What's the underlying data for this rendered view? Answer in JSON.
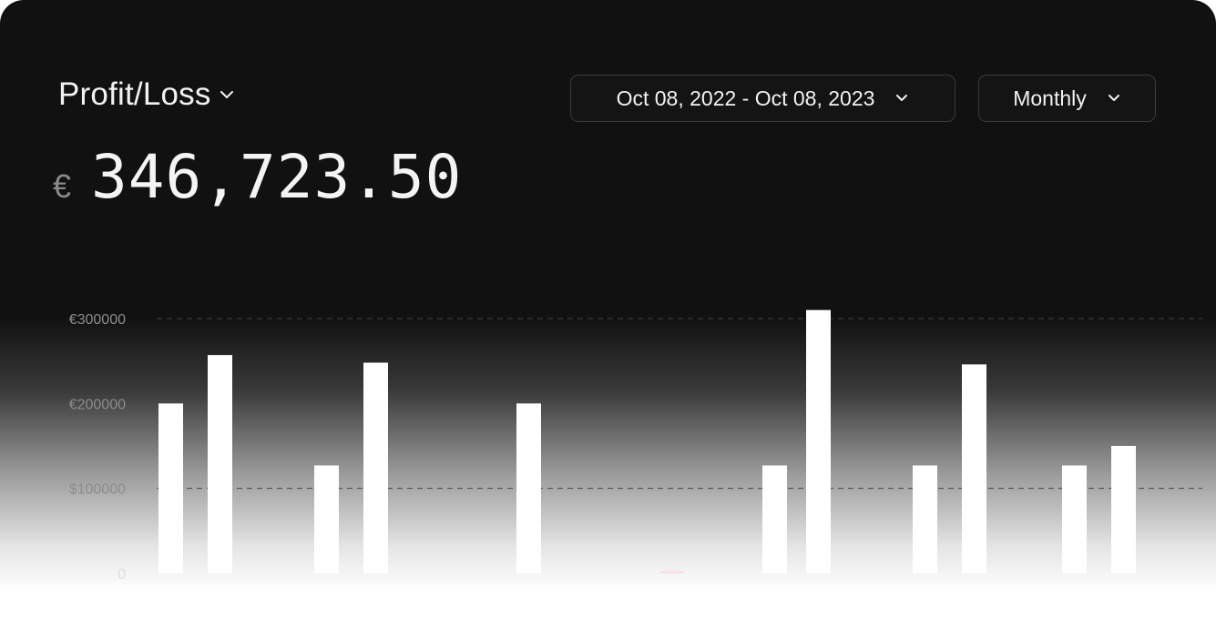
{
  "header": {
    "title": "Profit/Loss",
    "currency_symbol": "€",
    "amount": "346,723.50"
  },
  "controls": {
    "date_range": "Oct 08, 2022 - Oct 08, 2023",
    "period": "Monthly"
  },
  "colors": {
    "background_top": "#111111",
    "bar": "#ffffff",
    "highlight_bar": "#ffd6dc",
    "grid": "#444444"
  },
  "chart_data": {
    "type": "bar",
    "y_tick_labels": [
      "€300000",
      "€200000",
      "$100000",
      "0"
    ],
    "y_ticks": [
      300000,
      200000,
      100000,
      0
    ],
    "ylim": [
      0,
      300000
    ],
    "grid": true,
    "values": [
      200000,
      257000,
      127000,
      248000,
      200000,
      2000,
      127000,
      310000,
      127000,
      246000,
      127000,
      150000
    ],
    "highlight_index": 5
  }
}
